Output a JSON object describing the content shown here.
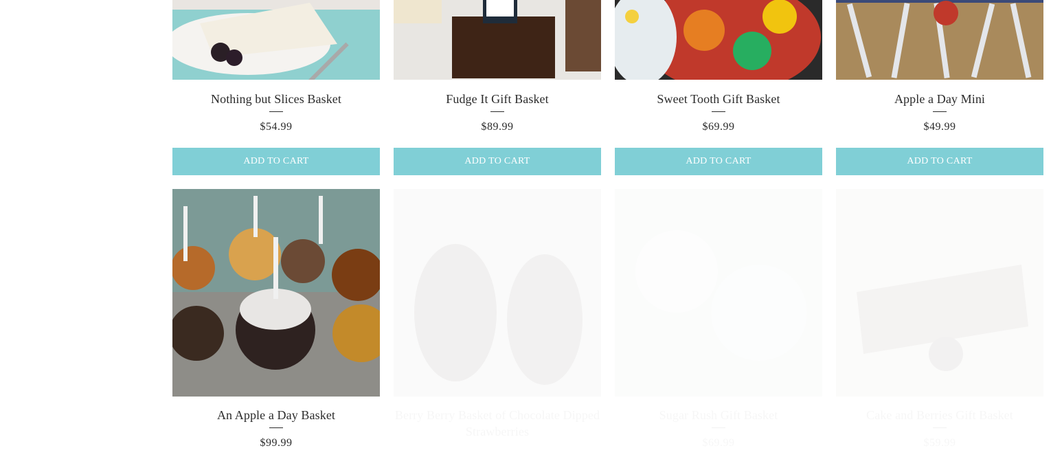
{
  "products": [
    {
      "name": "Nothing but Slices Basket",
      "price": "$54.99",
      "button": "ADD TO CART",
      "image": "cheesecake-slice-photo"
    },
    {
      "name": "Fudge It Gift Basket",
      "price": "$89.99",
      "button": "ADD TO CART",
      "image": "chocolate-fudge-photo"
    },
    {
      "name": "Sweet Tooth Gift Basket",
      "price": "$69.99",
      "button": "ADD TO CART",
      "image": "gummy-candy-jar-photo"
    },
    {
      "name": "Apple a Day Mini",
      "price": "$49.99",
      "button": "ADD TO CART",
      "image": "candy-apples-on-sticks-photo"
    },
    {
      "name": "An Apple a Day Basket",
      "price": "$99.99",
      "image": "caramel-apples-photo"
    },
    {
      "name": "Berry Berry Basket of Chocolate Dipped Strawberries",
      "image": "chocolate-strawberries-photo"
    },
    {
      "name": "Sugar Rush Gift Basket",
      "price": "$69.99",
      "image": "white-candy-photo"
    },
    {
      "name": "Cake and Berries Gift Basket",
      "price": "$59.99",
      "image": "cake-and-berries-photo"
    }
  ],
  "colors": {
    "button_bg": "#80cfd6",
    "button_text": "#ffffff",
    "text": "#2b2b2b"
  }
}
